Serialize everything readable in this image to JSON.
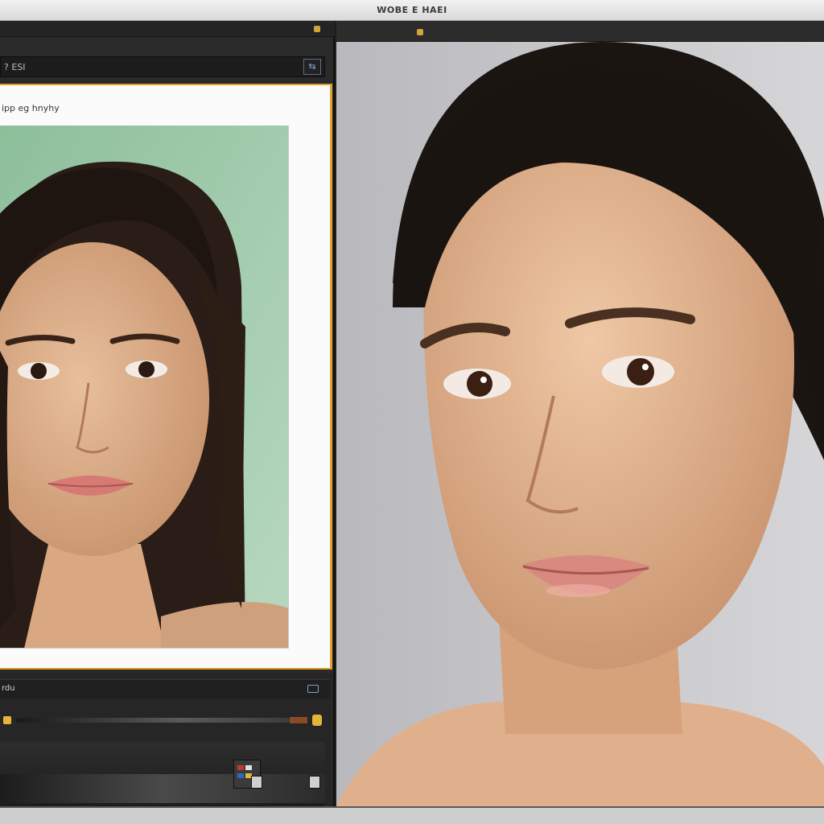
{
  "window": {
    "title": "WOBE E HAEI"
  },
  "left_panel": {
    "path_text": "? ESI",
    "go_button": "⇆",
    "preview_label": "ipp eg hnyhy",
    "tool_row_label": "rdu",
    "tool_row_icon": "monitor-icon"
  },
  "colors": {
    "accent": "#e2a030",
    "panel": "#2a2a2a",
    "left_backdrop": "#9cc9a8",
    "right_backdrop": "#c8c8cc"
  },
  "icons": [
    "yellow-indicator-icon",
    "monitor-icon",
    "go-icon"
  ]
}
